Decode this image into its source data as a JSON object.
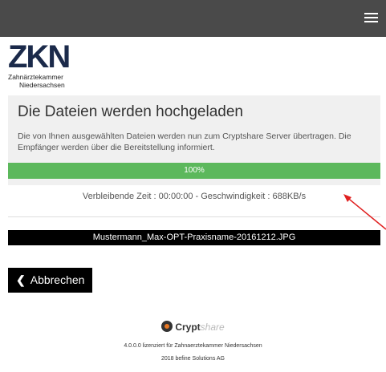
{
  "header": {
    "menu_icon": "hamburger-menu-icon",
    "background": "#4a4a4a"
  },
  "logo": {
    "mark": "ZKN",
    "line1": "Zahnärztekammer",
    "line2": "Niedersachsen"
  },
  "upload": {
    "title": "Die Dateien werden hochgeladen",
    "description": "Die von Ihnen ausgewählten Dateien werden nun zum Cryptshare Server übertragen. Die Empfänger werden über die Bereitstellung informiert.",
    "progress_value": 1.0,
    "progress_label": "100%",
    "progress_color": "#5cb85c",
    "stats": "Verbleibende Zeit : 00:00:00 -  Geschwindigkeit : 688KB/s"
  },
  "file": {
    "name": "Mustermann_Max-OPT-Praxisname-20161212.JPG"
  },
  "actions": {
    "cancel_label": "Abbrechen",
    "cancel_icon": "chevron-left-icon"
  },
  "footer": {
    "brand": "Crypt",
    "brand_suffix": "share",
    "license": "4.0.0.0 lizenziert für Zahnaerztekammer Niedersachsen",
    "copyright": "2018 befine Solutions AG"
  },
  "annotation_color": "#e02020"
}
